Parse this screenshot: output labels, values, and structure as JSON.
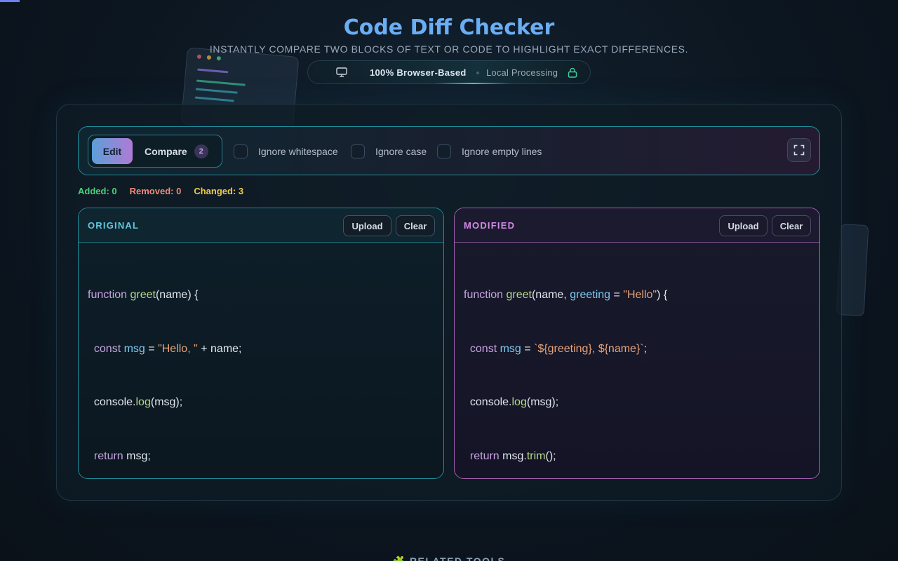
{
  "header": {
    "title": "Code Diff Checker",
    "subtitle": "INSTANTLY COMPARE TWO BLOCKS OF TEXT OR CODE TO HIGHLIGHT EXACT DIFFERENCES.",
    "pill_primary": "100% Browser-Based",
    "pill_secondary": "Local Processing"
  },
  "toolbar": {
    "edit_label": "Edit",
    "compare_label": "Compare",
    "compare_badge": "2",
    "options": [
      {
        "label": "Ignore whitespace",
        "checked": false
      },
      {
        "label": "Ignore case",
        "checked": false
      },
      {
        "label": "Ignore empty lines",
        "checked": false
      }
    ],
    "expand_icon": "fullscreen-icon"
  },
  "stats": {
    "added": "Added: 0",
    "removed": "Removed: 0",
    "changed": "Changed: 3"
  },
  "original": {
    "label": "ORIGINAL",
    "upload_label": "Upload",
    "clear_label": "Clear",
    "lines": [
      "function greet(name) {",
      "  const msg = \"Hello, \" + name;",
      "  console.log(msg);",
      "  return msg;",
      "}"
    ]
  },
  "modified": {
    "label": "MODIFIED",
    "upload_label": "Upload",
    "clear_label": "Clear",
    "lines": [
      "function greet(name, greeting = \"Hello\") {",
      "  const msg = `${greeting}, ${name}`;",
      "  console.log(msg);",
      "  return msg.trim();",
      "}"
    ]
  },
  "related": "🧩 RELATED TOOLS",
  "colors": {
    "title": "#6aaef5",
    "original_border": "#1e8c9a",
    "modified_border": "#a45fb0",
    "added": "#4ad07a",
    "removed": "#f08a7a",
    "changed": "#f2c94c"
  }
}
